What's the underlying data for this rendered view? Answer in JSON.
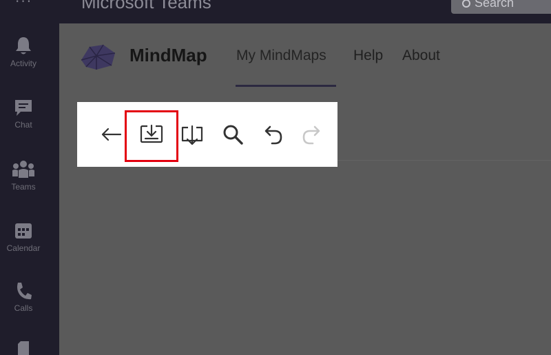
{
  "window": {
    "title": "Microsoft Teams",
    "search_placeholder": "Search"
  },
  "rail": {
    "items": [
      {
        "label": "Activity",
        "icon": "bell-icon"
      },
      {
        "label": "Chat",
        "icon": "chat-icon"
      },
      {
        "label": "Teams",
        "icon": "teams-icon"
      },
      {
        "label": "Calendar",
        "icon": "calendar-icon"
      },
      {
        "label": "Calls",
        "icon": "phone-icon"
      },
      {
        "label": "",
        "icon": "files-icon"
      }
    ]
  },
  "app": {
    "brand": "MindMap",
    "tabs": [
      {
        "label": "My MindMaps",
        "active": true
      },
      {
        "label": "Help",
        "active": false
      },
      {
        "label": "About",
        "active": false
      }
    ]
  },
  "toolbar": {
    "tools": [
      {
        "name": "back-arrow-icon",
        "enabled": true
      },
      {
        "name": "save-download-icon",
        "enabled": true,
        "highlighted": true
      },
      {
        "name": "export-download-icon",
        "enabled": true
      },
      {
        "name": "search-icon",
        "enabled": true
      },
      {
        "name": "undo-icon",
        "enabled": true
      },
      {
        "name": "redo-icon",
        "enabled": false
      }
    ]
  },
  "colors": {
    "highlight": "#e3000f",
    "rail_bg": "#1f1d2b",
    "overlay_bg": "#5a5a5a"
  }
}
